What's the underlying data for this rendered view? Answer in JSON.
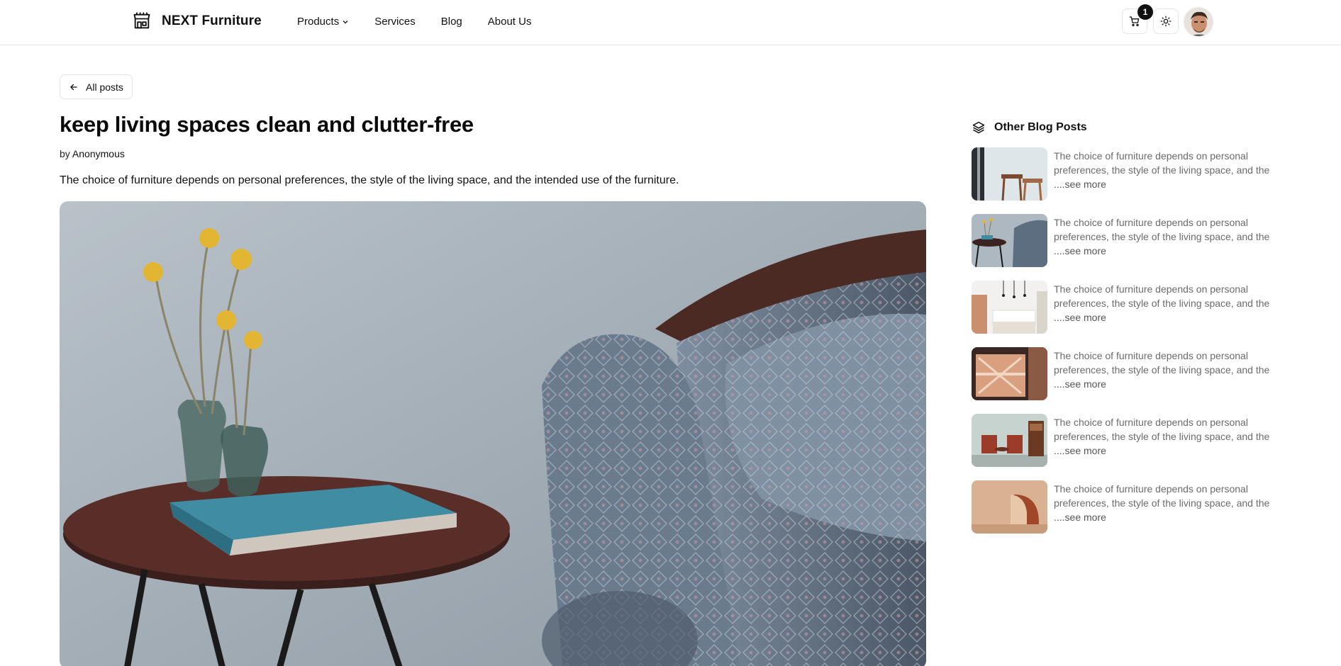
{
  "header": {
    "brand": "NEXT Furniture",
    "nav": [
      {
        "label": "Products",
        "has_dropdown": true
      },
      {
        "label": "Services"
      },
      {
        "label": "Blog"
      },
      {
        "label": "About Us"
      }
    ],
    "cart_count": "1",
    "icons": [
      "store-icon",
      "cart-icon",
      "sun-icon",
      "avatar"
    ]
  },
  "main": {
    "back_label": "All posts",
    "title": "keep living spaces clean and clutter-free",
    "by_prefix": "by",
    "author": "Anonymous",
    "lead": "The choice of furniture depends on personal preferences, the style of the living space, and the intended use of the furniture."
  },
  "sidebar": {
    "title": "Other Blog Posts",
    "posts": [
      {
        "line1": "The choice of furniture depends on personal",
        "line2": "preferences, the style of the living space, and the",
        "more": "....see more"
      },
      {
        "line1": "The choice of furniture depends on personal",
        "line2": "preferences, the style of the living space, and the",
        "more": "....see more"
      },
      {
        "line1": "The choice of furniture depends on personal",
        "line2": "preferences, the style of the living space, and the",
        "more": "....see more"
      },
      {
        "line1": "The choice of furniture depends on personal",
        "line2": "preferences, the style of the living space, and the",
        "more": "....see more"
      },
      {
        "line1": "The choice of furniture depends on personal",
        "line2": "preferences, the style of the living space, and the",
        "more": "....see more"
      },
      {
        "line1": "The choice of furniture depends on personal",
        "line2": "preferences, the style of the living space, and the",
        "more": "....see more"
      }
    ]
  }
}
